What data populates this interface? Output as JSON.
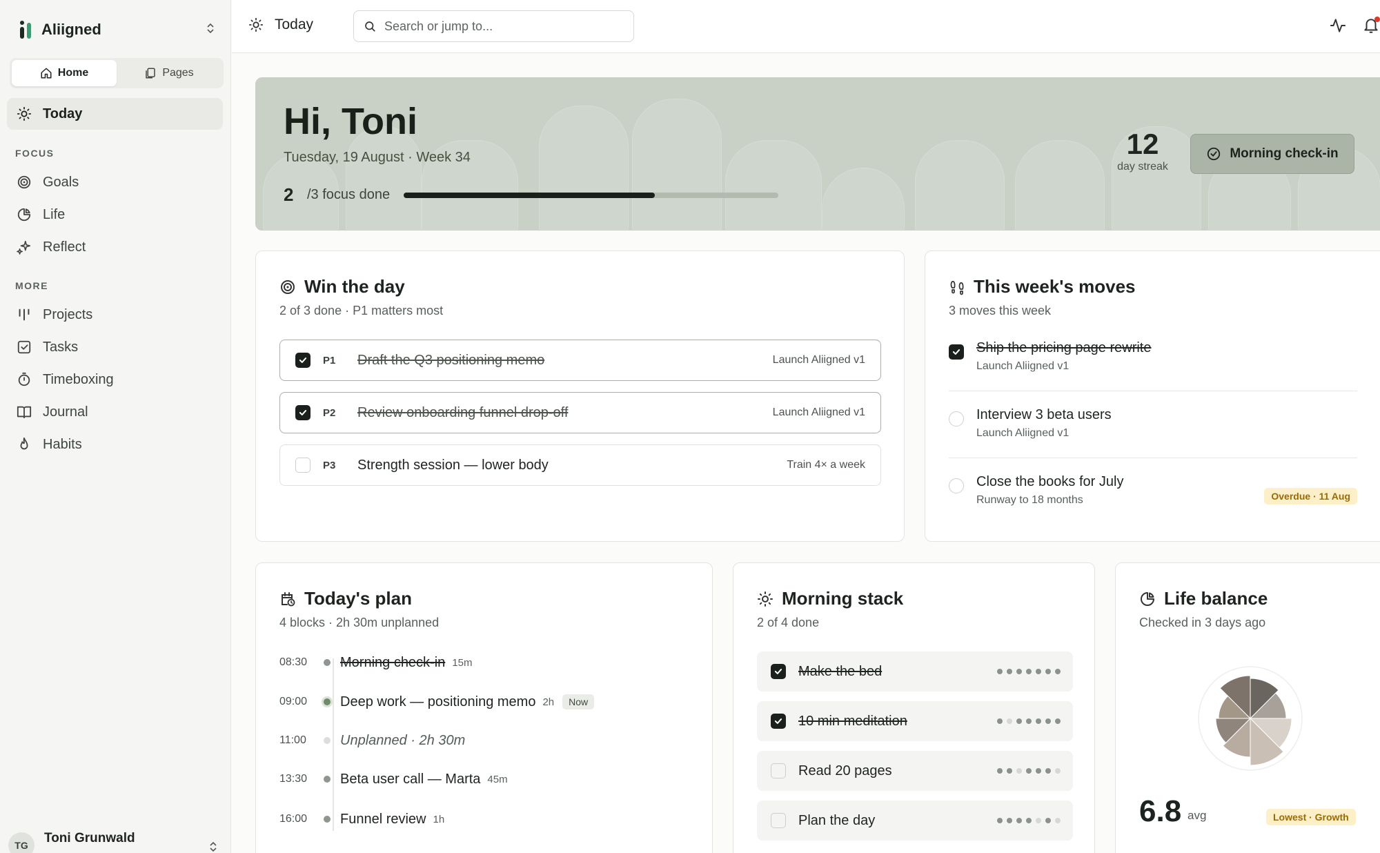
{
  "brand": {
    "name": "Aliigned"
  },
  "sidebar": {
    "segments": [
      {
        "label": "Home",
        "active": true
      },
      {
        "label": "Pages",
        "active": false
      }
    ],
    "today": "Today",
    "focus_label": "FOCUS",
    "focus_items": [
      "Goals",
      "Life",
      "Reflect"
    ],
    "more_label": "MORE",
    "more_items": [
      "Projects",
      "Tasks",
      "Timeboxing",
      "Journal",
      "Habits"
    ],
    "user": {
      "initials": "TG",
      "name": "Toni Grunwald"
    }
  },
  "topbar": {
    "title": "Today",
    "search_placeholder": "Search or jump to..."
  },
  "hero": {
    "greeting": "Hi, Toni",
    "date": "Tuesday, 19 August · Week 34",
    "focus_done": "2",
    "focus_label": "/3 focus done",
    "progress": 0.67,
    "streak_num": "12",
    "streak_label": "day streak",
    "checkin_label": "Morning check-in"
  },
  "win": {
    "title": "Win the day",
    "subtitle": "2 of 3 done · P1 matters most",
    "items": [
      {
        "tag": "P1",
        "text": "Draft the Q3 positioning memo",
        "goal": "Launch Aliigned v1",
        "done": true
      },
      {
        "tag": "P2",
        "text": "Review onboarding funnel drop-off",
        "goal": "Launch Aliigned v1",
        "done": true
      },
      {
        "tag": "P3",
        "text": "Strength session — lower body",
        "goal": "Train 4× a week",
        "done": false
      }
    ]
  },
  "moves": {
    "title": "This week's moves",
    "subtitle": "3 moves this week",
    "items": [
      {
        "title": "Ship the pricing page rewrite",
        "goal": "Launch Aliigned v1",
        "done": true,
        "badge": ""
      },
      {
        "title": "Interview 3 beta users",
        "goal": "Launch Aliigned v1",
        "done": false,
        "badge": ""
      },
      {
        "title": "Close the books for July",
        "goal": "Runway to 18 months",
        "done": false,
        "badge": "Overdue · 11 Aug"
      }
    ]
  },
  "plan": {
    "title": "Today's plan",
    "subtitle": "4 blocks · 2h 30m unplanned",
    "rows": [
      {
        "time": "08:30",
        "text": "Morning check-in",
        "dur": "15m",
        "state": "done"
      },
      {
        "time": "09:00",
        "text": "Deep work — positioning memo",
        "dur": "2h",
        "state": "now",
        "badge": "Now"
      },
      {
        "time": "11:00",
        "text": "Unplanned · 2h 30m",
        "dur": "",
        "state": "unplanned"
      },
      {
        "time": "13:30",
        "text": "Beta user call — Marta",
        "dur": "45m",
        "state": "todo"
      },
      {
        "time": "16:00",
        "text": "Funnel review",
        "dur": "1h",
        "state": "todo"
      }
    ]
  },
  "morning": {
    "title": "Morning stack",
    "subtitle": "2 of 4 done",
    "habits": [
      {
        "text": "Make the bed",
        "done": true,
        "week": [
          1,
          1,
          1,
          1,
          1,
          1,
          1
        ]
      },
      {
        "text": "10 min meditation",
        "done": true,
        "week": [
          1,
          0,
          1,
          1,
          1,
          1,
          1
        ]
      },
      {
        "text": "Read 20 pages",
        "done": false,
        "week": [
          1,
          1,
          0,
          1,
          1,
          1,
          0
        ]
      },
      {
        "text": "Plan the day",
        "done": false,
        "week": [
          1,
          1,
          1,
          1,
          0,
          1,
          0
        ]
      }
    ]
  },
  "balance": {
    "title": "Life balance",
    "subtitle": "Checked in 3 days ago",
    "avg": "6.8",
    "avg_label": "avg",
    "badge": "Lowest · Growth",
    "colors": [
      "#6b6560",
      "#a8a19a",
      "#d9d2ca",
      "#c9bfb4",
      "#b8aca0",
      "#8f857c",
      "#a39787",
      "#7d736b"
    ]
  }
}
